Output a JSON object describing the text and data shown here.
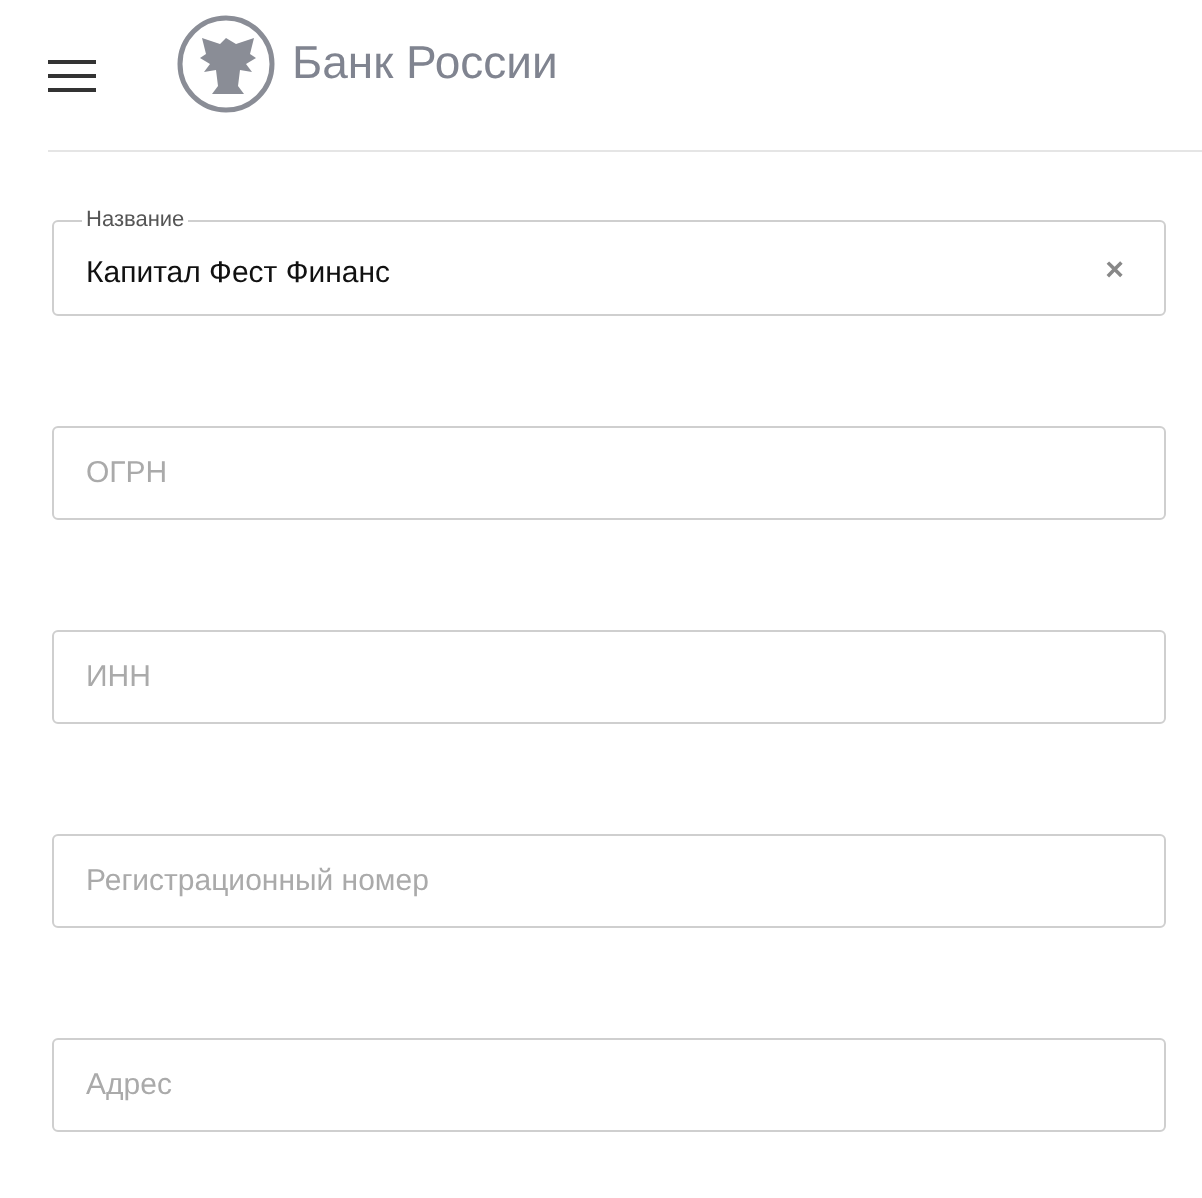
{
  "header": {
    "brand": "Банк России"
  },
  "fields": [
    {
      "label": "Название",
      "value": "Капитал Фест Финанс",
      "clear": "×"
    },
    {
      "placeholder": "ОГРН"
    },
    {
      "placeholder": "ИНН"
    },
    {
      "placeholder": "Регистрационный номер"
    },
    {
      "placeholder": "Адрес"
    }
  ]
}
